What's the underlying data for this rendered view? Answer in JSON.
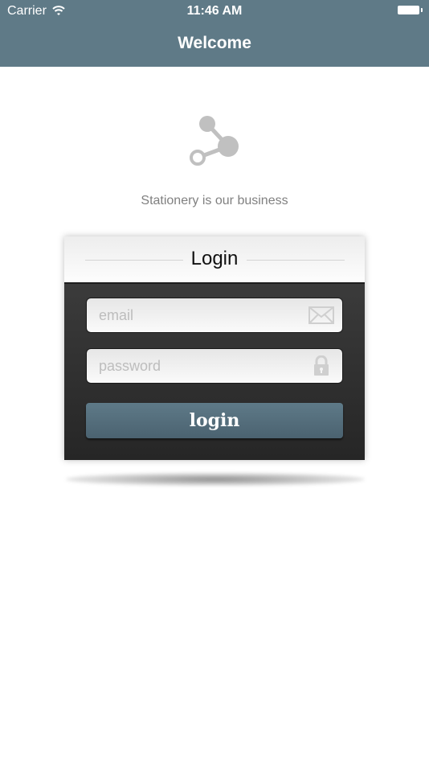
{
  "status_bar": {
    "carrier": "Carrier",
    "time": "11:46 AM",
    "wifi_icon": "wifi-icon",
    "battery_icon": "battery-icon"
  },
  "nav": {
    "title": "Welcome",
    "background_color": "#5f7a87"
  },
  "brand": {
    "logo_icon": "share-nodes-icon",
    "tagline": "Stationery is our business"
  },
  "login_card": {
    "title": "Login",
    "email": {
      "value": "",
      "placeholder": "email",
      "icon": "envelope-icon"
    },
    "password": {
      "value": "",
      "placeholder": "password",
      "icon": "lock-icon"
    },
    "submit_label": "login",
    "accent_color": "#5e7a88"
  }
}
